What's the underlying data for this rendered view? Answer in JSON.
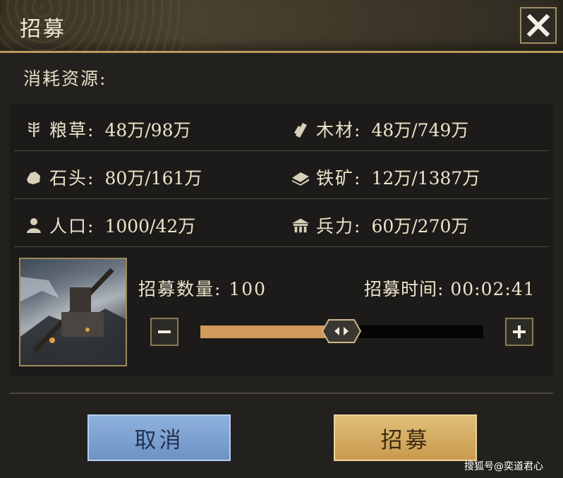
{
  "header": {
    "title": "招募"
  },
  "section_label": "消耗资源:",
  "resources": [
    {
      "icon": "grain-icon",
      "label": "粮草:",
      "value": "48万/98万"
    },
    {
      "icon": "wood-icon",
      "label": "木材:",
      "value": "48万/749万"
    },
    {
      "icon": "stone-icon",
      "label": "石头:",
      "value": "80万/161万"
    },
    {
      "icon": "iron-ore-icon",
      "label": "铁矿:",
      "value": "12万/1387万"
    },
    {
      "icon": "population-icon",
      "label": "人口:",
      "value": "1000/42万"
    },
    {
      "icon": "troops-icon",
      "label": "兵力:",
      "value": "60万/270万"
    }
  ],
  "recruit": {
    "quantity_text": "招募数量: 100",
    "time_text": "招募时间: 00:02:41",
    "slider_fraction": 0.49
  },
  "buttons": {
    "cancel": "取消",
    "confirm": "招募"
  },
  "watermark": "搜狐号@奕道君心",
  "colors": {
    "accent_gold": "#b79c5f",
    "slider_fill": "#d19a5c",
    "cancel_blue": "#7ea2d2",
    "confirm_gold": "#d6ad63"
  }
}
